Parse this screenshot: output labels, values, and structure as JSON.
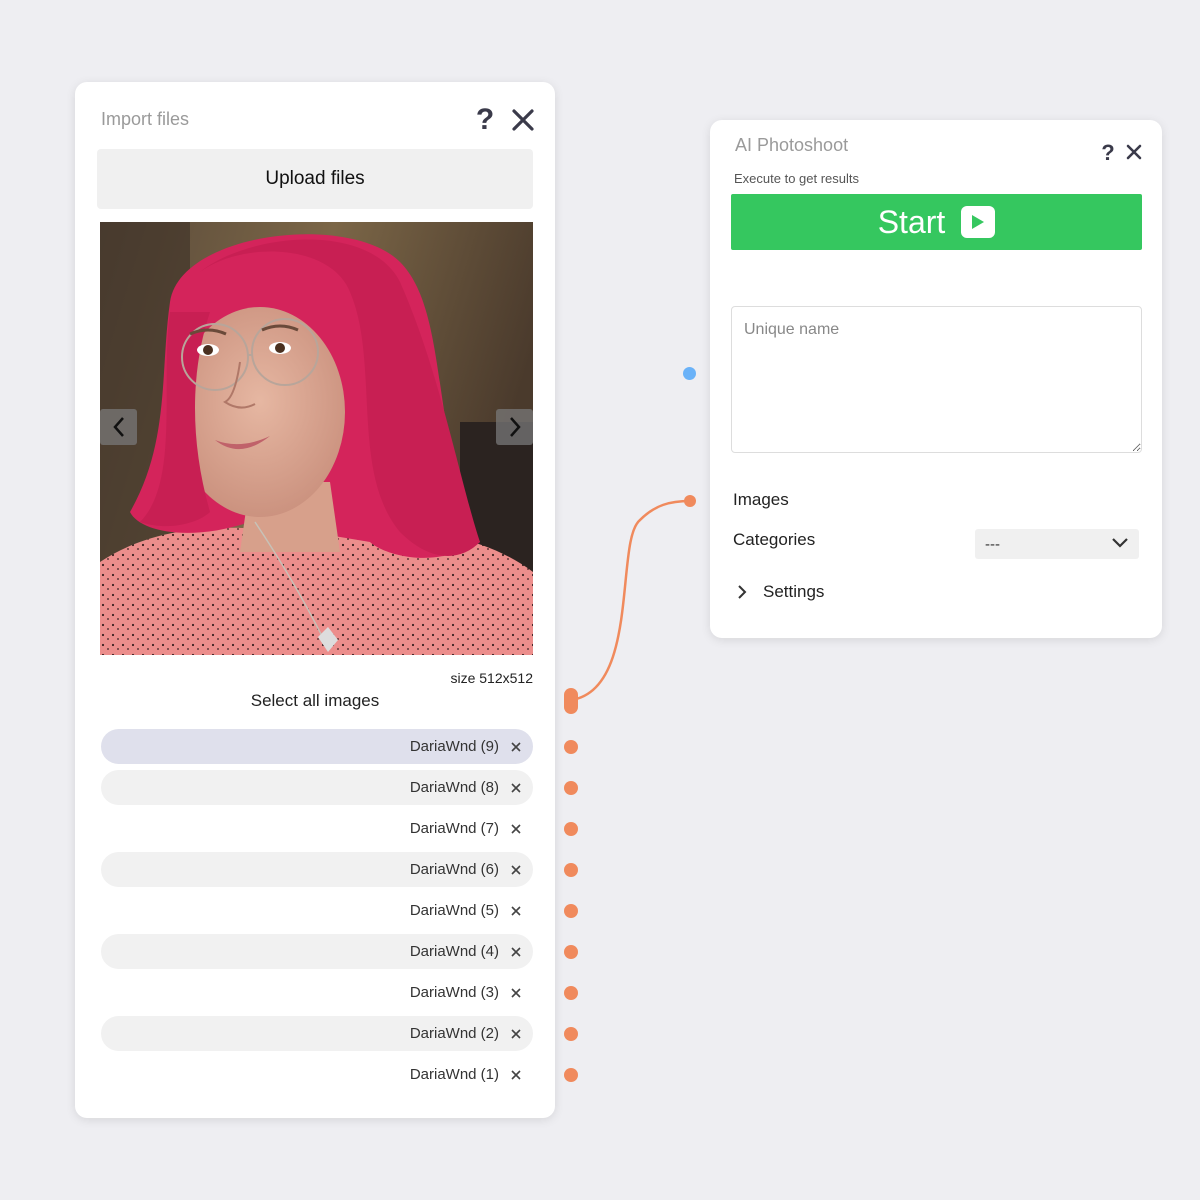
{
  "import_node": {
    "title": "Import files",
    "help_icon": "?",
    "upload_label": "Upload files",
    "photo_description_icon": "photo",
    "size_label": "size 512x512",
    "select_all_label": "Select all images",
    "files": [
      {
        "name": "DariaWnd (9)",
        "remove": "×",
        "state": "selected"
      },
      {
        "name": "DariaWnd (8)",
        "remove": "×",
        "state": "shaded"
      },
      {
        "name": "DariaWnd (7)",
        "remove": "×",
        "state": "plain"
      },
      {
        "name": "DariaWnd (6)",
        "remove": "×",
        "state": "shaded"
      },
      {
        "name": "DariaWnd (5)",
        "remove": "×",
        "state": "plain"
      },
      {
        "name": "DariaWnd (4)",
        "remove": "×",
        "state": "shaded"
      },
      {
        "name": "DariaWnd (3)",
        "remove": "×",
        "state": "plain"
      },
      {
        "name": "DariaWnd (2)",
        "remove": "×",
        "state": "shaded"
      },
      {
        "name": "DariaWnd (1)",
        "remove": "×",
        "state": "plain"
      }
    ]
  },
  "ai_node": {
    "title": "AI Photoshoot",
    "help_icon": "?",
    "subtitle": "Execute to get results",
    "start_label": "Start",
    "name_placeholder": "Unique name",
    "images_label": "Images",
    "categories_label": "Categories",
    "categories_value": "---",
    "settings_label": "Settings"
  },
  "colors": {
    "background": "#eeeef2",
    "start_green": "#35c75f",
    "port_orange": "#f08a5d",
    "port_blue": "#6ab2f8",
    "selected_row": "#dfe0ec"
  }
}
